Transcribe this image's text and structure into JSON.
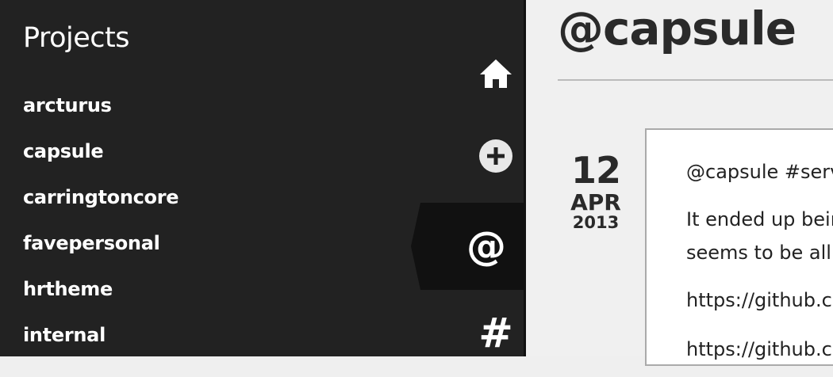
{
  "sidebar": {
    "title": "Projects",
    "projects": [
      {
        "label": "arcturus"
      },
      {
        "label": "capsule"
      },
      {
        "label": "carringtoncore"
      },
      {
        "label": "favepersonal"
      },
      {
        "label": "hrtheme"
      },
      {
        "label": "internal"
      }
    ],
    "nav": {
      "home_icon": "home-icon",
      "add_icon": "plus-circle-icon",
      "mentions_label": "@",
      "tags_label": "#"
    }
  },
  "main": {
    "title": "@capsule",
    "post": {
      "date": {
        "day": "12",
        "month": "APR",
        "year": "2013"
      },
      "lines": [
        "@capsule #serv",
        "It ended up bein",
        "seems to be all",
        "https://github.c",
        "https://github.c"
      ]
    }
  },
  "colors": {
    "sidebar_bg": "#222222",
    "active_nav_bg": "#111111",
    "main_bg": "#f0f0f0",
    "text_light": "#ffffff",
    "text_dark": "#2a2a2a"
  }
}
